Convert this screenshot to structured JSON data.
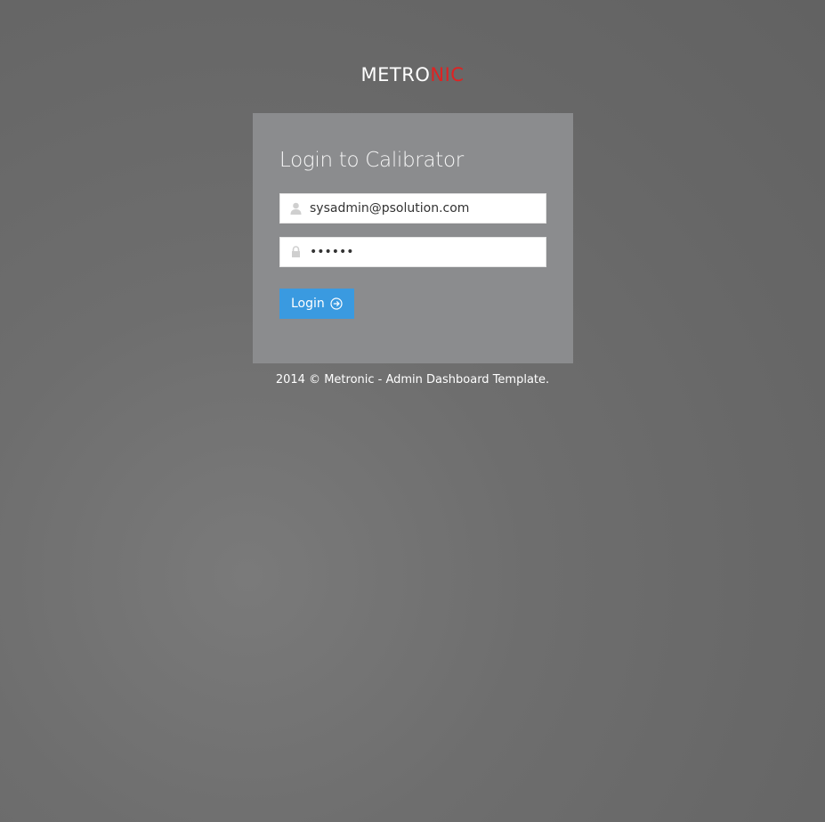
{
  "logo": {
    "text_main": "METRO",
    "text_accent": "NIC",
    "accent_color": "#e02222"
  },
  "login": {
    "title": "Login to Calibrator",
    "email": {
      "value": "sysadmin@psolution.com",
      "icon": "user-icon"
    },
    "password": {
      "value": "••••••",
      "icon": "lock-icon"
    },
    "button_label": "Login",
    "button_icon": "arrow-right-circle-icon",
    "button_color": "#3a9ae0"
  },
  "footer": {
    "copyright": "2014 © Metronic - Admin Dashboard Template."
  }
}
